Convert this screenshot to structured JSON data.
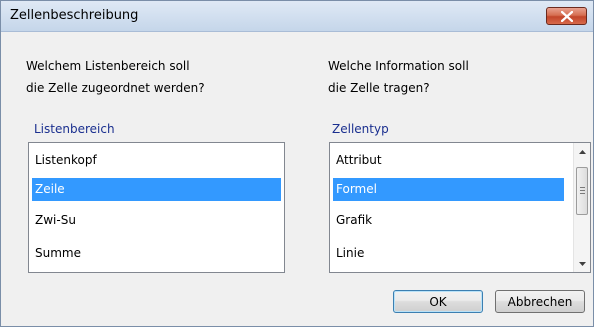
{
  "dialog": {
    "title": "Zellenbeschreibung",
    "close_icon": "close-icon"
  },
  "left": {
    "question_line1": "Welchem Listenbereich soll",
    "question_line2": "die Zelle zugeordnet werden?",
    "group_label": "Listenbereich",
    "items": [
      "Listenkopf",
      "Zeile",
      "Zwi-Su",
      "Summe"
    ],
    "selected": "Zeile"
  },
  "right": {
    "question_line1": "Welche Information soll",
    "question_line2": "die Zelle tragen?",
    "group_label": "Zellentyp",
    "items": [
      "Attribut",
      "Formel",
      "Grafik",
      "Linie"
    ],
    "selected": "Formel"
  },
  "buttons": {
    "ok": "OK",
    "cancel": "Abbrechen"
  },
  "colors": {
    "selection": "#3399ff",
    "group_label": "#1a2f8f",
    "close_button": "#c2452a"
  }
}
